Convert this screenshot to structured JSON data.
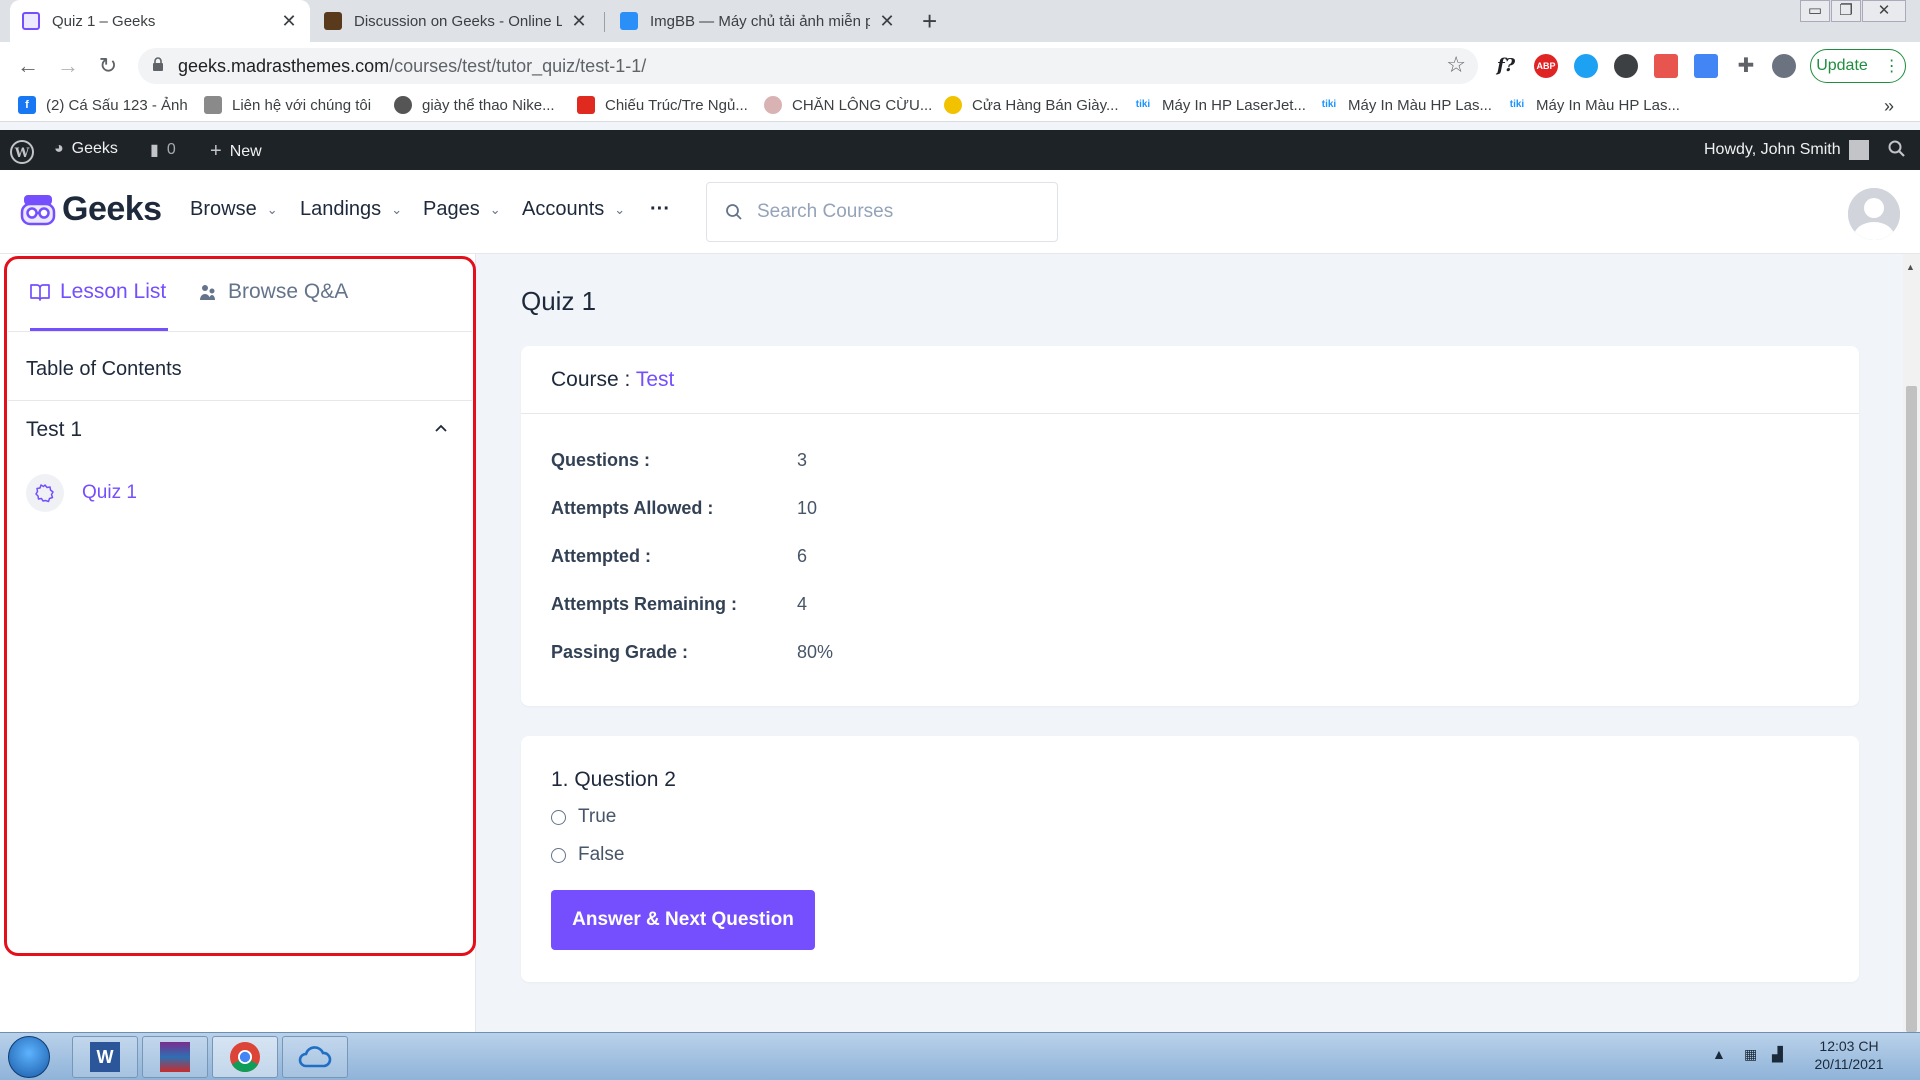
{
  "browser": {
    "tabs": [
      {
        "title": "Quiz 1 – Geeks",
        "active": true
      },
      {
        "title": "Discussion on Geeks - Online Lea",
        "active": false
      },
      {
        "title": "ImgBB — Máy chủ tải ảnh miễn p",
        "active": false
      }
    ],
    "url_host": "geeks.madrasthemes.com",
    "url_path": "/courses/test/tutor_quiz/test-1-1/",
    "update_label": "Update",
    "font_ext_label": "f?",
    "abp_label": "ABP"
  },
  "bookmarks": [
    {
      "label": "(2) Cá Sấu 123 - Ảnh",
      "color": "#1877f2",
      "icon": "f"
    },
    {
      "label": "Liên hệ với chúng tôi",
      "color": "#8a8a8a",
      "icon": ""
    },
    {
      "label": "giày thể thao Nike...",
      "color": "#555555",
      "icon": ""
    },
    {
      "label": "Chiếu Trúc/Tre Ngủ...",
      "color": "#e02a20",
      "icon": ""
    },
    {
      "label": "CHĂN LÔNG CỪU...",
      "color": "#c99",
      "icon": ""
    },
    {
      "label": "Cửa Hàng Bán Giày...",
      "color": "#f2c200",
      "icon": ""
    },
    {
      "label": "Máy In HP LaserJet...",
      "color": "#1a94ff",
      "icon": "tiki"
    },
    {
      "label": "Máy In Màu HP Las...",
      "color": "#1a94ff",
      "icon": "tiki"
    },
    {
      "label": "Máy In Màu HP Las...",
      "color": "#1a94ff",
      "icon": "tiki"
    }
  ],
  "wpbar": {
    "site": "Geeks",
    "comments": "0",
    "new": "New",
    "greeting": "Howdy, John Smith"
  },
  "header": {
    "logo": "Geeks",
    "menu": [
      "Browse",
      "Landings",
      "Pages",
      "Accounts"
    ],
    "more": "···",
    "search_placeholder": "Search Courses"
  },
  "sidebar": {
    "tab_lessons": "Lesson List",
    "tab_qa": "Browse Q&A",
    "toc_title": "Table of Contents",
    "section": "Test 1",
    "lessons": [
      {
        "label": "Quiz 1"
      }
    ]
  },
  "main": {
    "title": "Quiz 1",
    "course_label": "Course :",
    "course_name": "Test",
    "info": [
      {
        "label": "Questions :",
        "value": "3"
      },
      {
        "label": "Attempts Allowed :",
        "value": "10"
      },
      {
        "label": "Attempted :",
        "value": "6"
      },
      {
        "label": "Attempts Remaining :",
        "value": "4"
      },
      {
        "label": "Passing Grade :",
        "value": "80%"
      }
    ],
    "question": "1. Question 2",
    "options": [
      "True",
      "False"
    ],
    "submit": "Answer & Next Question"
  },
  "taskbar": {
    "time": "12:03 CH",
    "date": "20/11/2021"
  },
  "colors": {
    "accent": "#754ffe",
    "highlight": "#e3101b"
  }
}
